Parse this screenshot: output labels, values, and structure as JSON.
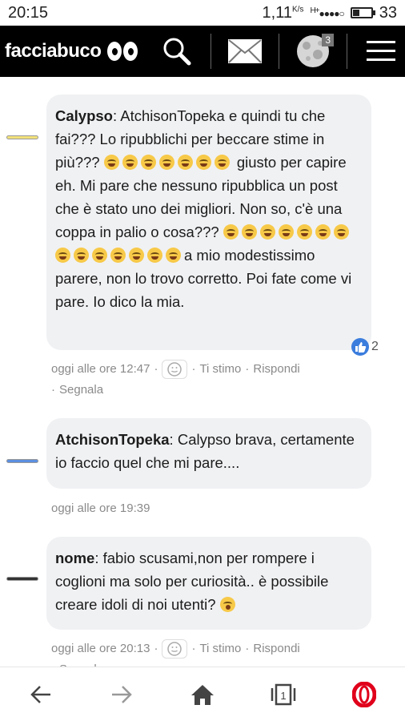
{
  "status": {
    "time": "20:15",
    "speed": "1,11",
    "speed_unit": "K/s",
    "network": "H+",
    "battery": "33",
    "battery_level": 0.33
  },
  "header": {
    "brand": "facciabuco",
    "notifications_count": "3"
  },
  "comments": [
    {
      "author": "Calypso",
      "avatar_color": "#f2e27a",
      "parts": [
        "AtchisonTopeka e quindi tu che fai??? Lo ripubblichi per beccare stime in più??? ",
        " giusto per capire eh. Mi pare che nessuno ripubblica un post che è stato uno dei migliori. Non so, c'è una coppa in palio o cosa??? ",
        "a mio modestissimo parere, non lo trovo corretto. Poi fate come vi pare. Io dico la mia."
      ],
      "likes": "2",
      "time": "oggi alle ore 12:47",
      "actions": [
        "Ti stimo",
        "Rispondi",
        "Segnala"
      ]
    },
    {
      "author": "AtchisonTopeka",
      "avatar_color": "#5b8fe0",
      "text": "Calypso brava, certamente io faccio quel che mi pare....",
      "time": "oggi alle ore 19:39"
    },
    {
      "author": "nome",
      "avatar_color": "#333333",
      "text": "fabio scusami,non per rompere i coglioni ma solo per curiosità.. è possibile creare idoli di noi utenti? ",
      "time": "oggi alle ore 20:13",
      "actions": [
        "Ti stimo",
        "Rispondi",
        "Segnala"
      ]
    }
  ],
  "colors": {
    "header_bg": "#000000",
    "bubble_bg": "#f0f1f3",
    "opera_red": "#e0001b",
    "like_blue": "#3b7ddd"
  }
}
